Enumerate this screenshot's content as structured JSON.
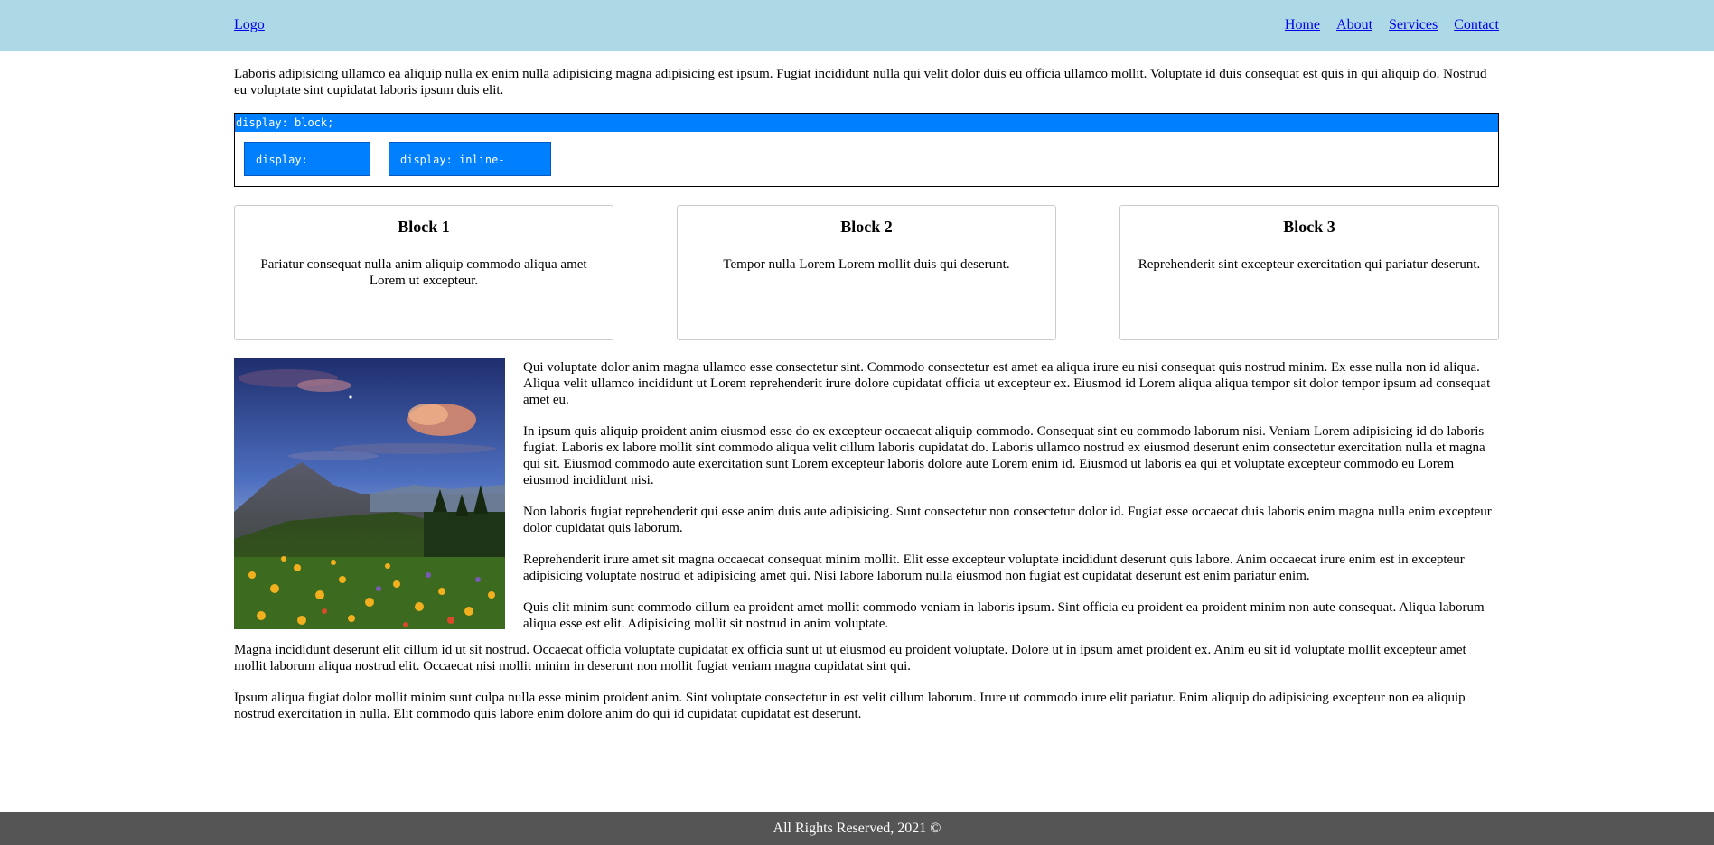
{
  "header": {
    "logo": "Logo",
    "nav": [
      "Home",
      "About",
      "Services",
      "Contact"
    ]
  },
  "intro": "Laboris adipisicing ullamco ea aliquip nulla ex enim nulla adipisicing magna adipisicing est ipsum. Fugiat incididunt nulla qui velit dolor duis eu officia ullamco mollit. Voluptate id duis consequat est quis in qui aliquip do. Nostrud eu voluptate sint cupidatat laboris ipsum duis elit.",
  "display_demo": {
    "block": "display: block;",
    "inline": "display: inline;",
    "inline_block": "display: inline-block;"
  },
  "cards": [
    {
      "title": "Block 1",
      "text": "Pariatur consequat nulla anim aliquip commodo aliqua amet Lorem ut excepteur."
    },
    {
      "title": "Block 2",
      "text": "Tempor nulla Lorem Lorem mollit duis qui deserunt."
    },
    {
      "title": "Block 3",
      "text": "Reprehenderit sint excepteur exercitation qui pariatur deserunt."
    }
  ],
  "article": [
    "Qui voluptate dolor anim magna ullamco esse consectetur sint. Commodo consectetur est amet ea aliqua irure eu nisi consequat quis nostrud minim. Ex esse nulla non id aliqua. Aliqua velit ullamco incididunt ut Lorem reprehenderit irure dolore cupidatat officia ut excepteur ex. Eiusmod id Lorem aliqua aliqua tempor sit dolor tempor ipsum ad consequat amet eu.",
    "In ipsum quis aliquip proident anim eiusmod esse do ex excepteur occaecat aliquip commodo. Consequat sint eu commodo laborum nisi. Veniam Lorem adipisicing id do laboris fugiat. Laboris ex labore mollit sint commodo aliqua velit cillum laboris cupidatat do. Laboris ullamco nostrud ex eiusmod deserunt enim consectetur exercitation nulla et magna qui sit. Eiusmod commodo aute exercitation sunt Lorem excepteur laboris dolore aute Lorem enim id. Eiusmod ut laboris ea qui et voluptate excepteur commodo eu Lorem eiusmod incididunt nisi.",
    "Non laboris fugiat reprehenderit qui esse anim duis aute adipisicing. Sunt consectetur non consectetur dolor id. Fugiat esse occaecat duis laboris enim magna nulla enim excepteur dolor cupidatat quis laborum.",
    "Reprehenderit irure amet sit magna occaecat consequat minim mollit. Elit esse excepteur voluptate incididunt deserunt quis labore. Anim occaecat irure enim est in excepteur adipisicing voluptate nostrud et adipisicing amet qui. Nisi labore laborum nulla eiusmod non fugiat est cupidatat deserunt est enim pariatur enim.",
    "Quis elit minim sunt commodo cillum ea proident amet mollit commodo veniam in laboris ipsum. Sint officia eu proident ea proident minim non aute consequat. Aliqua laborum aliqua esse est elit. Adipisicing mollit sit nostrud in anim voluptate."
  ],
  "lower": [
    "Magna incididunt deserunt elit cillum id ut sit nostrud. Occaecat officia voluptate cupidatat ex officia sunt ut ut eiusmod eu proident voluptate. Dolore ut in ipsum amet proident ex. Anim eu sit id voluptate mollit excepteur amet mollit laborum aliqua nostrud elit. Occaecat nisi mollit minim in deserunt non mollit fugiat veniam magna cupidatat sint qui.",
    "Ipsum aliqua fugiat dolor mollit minim sunt culpa nulla esse minim proident anim. Sint voluptate consectetur in est velit cillum laborum. Irure ut commodo irure elit pariatur. Enim aliquip do adipisicing excepteur non ea aliquip nostrud exercitation in nulla. Elit commodo quis labore enim dolore anim do qui id cupidatat cupidatat est deserunt."
  ],
  "footer": "All Rights Reserved, 2021 ©",
  "colors": {
    "header_bg": "#add8e6",
    "demo_blue": "#0080ff",
    "footer_bg": "#555555",
    "link": "#0000ee"
  }
}
